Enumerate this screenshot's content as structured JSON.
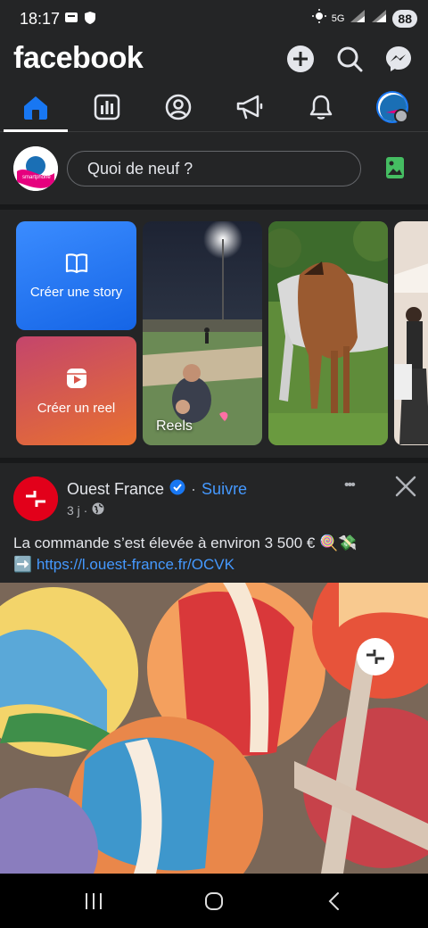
{
  "status_bar": {
    "time": "18:17",
    "network": "5G",
    "battery": "88"
  },
  "header": {
    "logo": "facebook"
  },
  "composer": {
    "placeholder": "Quoi de neuf ?"
  },
  "stories": {
    "create_story": "Créer une story",
    "create_reel": "Créer un reel",
    "reels_label": "Reels"
  },
  "post": {
    "page_name": "Ouest France",
    "separator": "·",
    "follow": "Suivre",
    "time": "3 j ·",
    "text": "La commande s’est élevée à environ 3 500 € 🍭💸",
    "link_prefix": "➡️",
    "link": "https://l.ouest-france.fr/OCVK",
    "more": "•••"
  },
  "colors": {
    "background": "#242526",
    "divider": "#18191a",
    "accent_blue": "#1877f2",
    "link_blue": "#4599ff",
    "brand_red": "#e2001a",
    "photo_green": "#45bd62"
  },
  "icons": {
    "home": "home-icon",
    "dashboard": "dashboard-icon",
    "profile": "profile-icon",
    "ads": "megaphone-icon",
    "notifications": "bell-icon",
    "add": "plus-icon",
    "search": "search-icon",
    "messenger": "messenger-icon"
  }
}
